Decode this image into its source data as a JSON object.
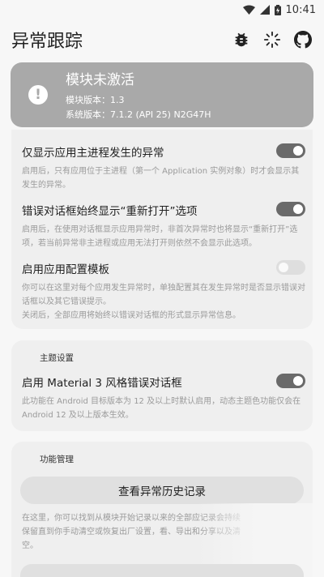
{
  "status_bar": {
    "time": "10:41"
  },
  "app_bar": {
    "title": "异常跟踪",
    "actions": [
      {
        "name": "bug-icon"
      },
      {
        "name": "loading-icon"
      },
      {
        "name": "github-icon"
      }
    ]
  },
  "module_status": {
    "title": "模块未激活",
    "version_line": "模块版本：1.3",
    "system_line": "系统版本：7.1.2 (API 25) N2G47H"
  },
  "settings": [
    {
      "label": "仅显示应用主进程发生的异常",
      "desc": "启用后，只有应用位于主进程（第一个 Application 实例对象）时才会显示其发生的异常。",
      "enabled": true
    },
    {
      "label": "错误对话框始终显示“重新打开”选项",
      "desc": "启用后，在使用对话框显示应用异常时，非首次异常时也将显示“重新打开”选项，若当前异常非主进程或应用无法打开则依然不会显示此选项。",
      "enabled": true
    },
    {
      "label": "启用应用配置模板",
      "desc": "你可以在这里对每个应用发生异常时，单独配置其在发生异常时是否显示错误对话框以及其它错误提示。",
      "desc2": "关闭后，全部应用将始终以错误对话框的形式显示异常信息。",
      "enabled": false
    }
  ],
  "theme_section": {
    "header": "主题设置",
    "label": "启用 Material 3 风格错误对话框",
    "desc": "此功能在 Android 目标版本为 12 及以上时默认启用，动态主题色功能仅会在 Android 12 及以上版本生效。",
    "enabled": true
  },
  "feature_section": {
    "header": "功能管理",
    "button_label": "查看异常历史记录",
    "desc": "在这里，你可以找到从模块开始记录以来的全部应记录会持续保留直到你手动清空或恢复出厂设置，看、导出和分享以及清空。"
  }
}
